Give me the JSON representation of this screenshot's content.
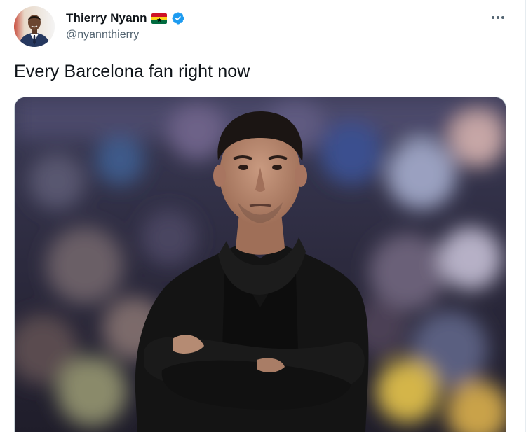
{
  "author": {
    "display_name": "Thierry Nyann",
    "handle": "@nyannthierry",
    "flag_icon": "ghana-flag-icon",
    "verified_icon": "verified-badge-icon",
    "verified_color": "#1d9bf0"
  },
  "tweet": {
    "text": "Every Barcelona fan right now"
  },
  "media": {
    "kind": "photo",
    "subject": "photo-of-man-with-crossed-arms"
  },
  "menu": {
    "icon": "more-options-icon"
  },
  "colors": {
    "text_primary": "#0f1419",
    "text_secondary": "#536471",
    "border": "#cfd9de"
  }
}
